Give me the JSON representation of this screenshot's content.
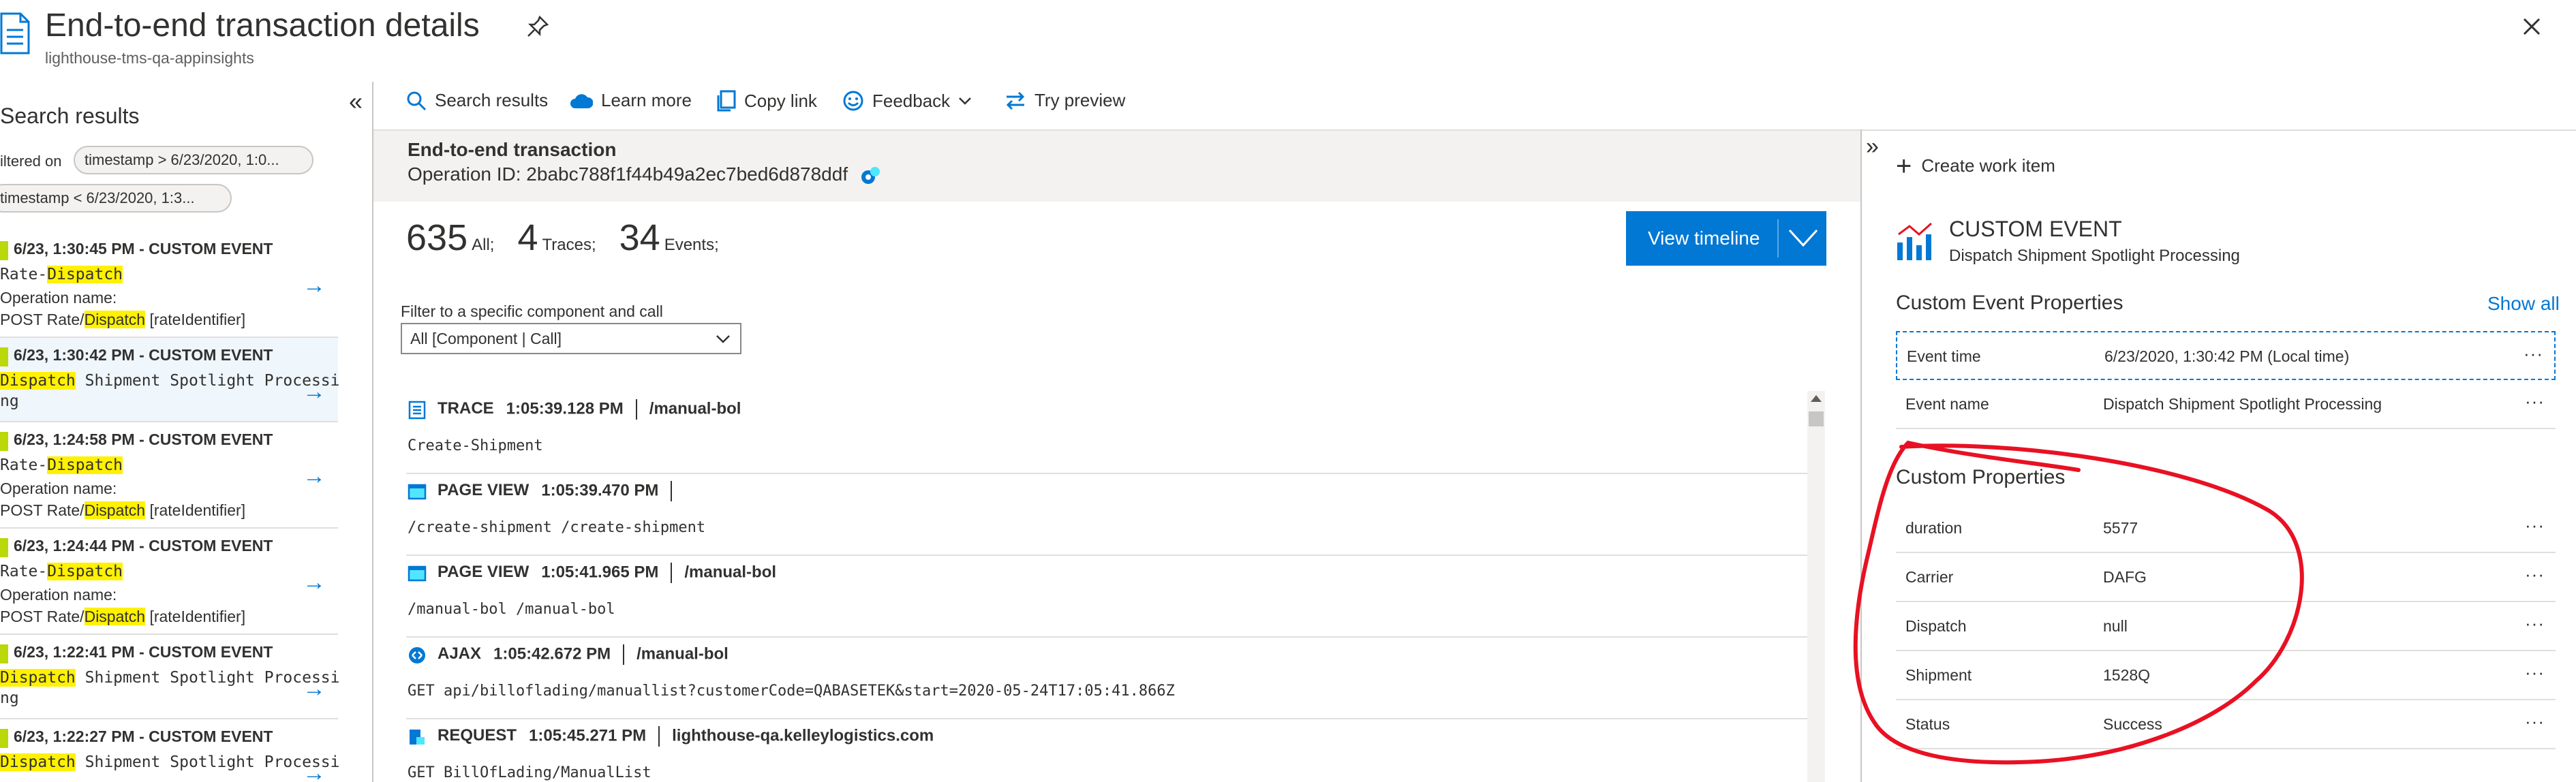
{
  "header": {
    "title": "End-to-end transaction details",
    "subtitle": "lighthouse-tms-qa-appinsights"
  },
  "left_panel": {
    "title": "Search results",
    "filter_label": "iltered on",
    "chips": [
      "timestamp > 6/23/2020, 1:0...",
      "timestamp < 6/23/2020, 1:3..."
    ],
    "results": [
      {
        "header": "6/23, 1:30:45 PM - CUSTOM EVENT",
        "line1_pre": "Rate-",
        "line1_hl": "Dispatch",
        "line1_post": "",
        "op_label": "Operation name:",
        "op_pre": "POST Rate/",
        "op_hl": "Dispatch",
        "op_post": " [rateIdentifier]"
      },
      {
        "header": "6/23, 1:30:42 PM - CUSTOM EVENT",
        "line1_pre": "",
        "line1_hl": "Dispatch",
        "line1_post": " Shipment Spotlight Processi",
        "line2": "ng"
      },
      {
        "header": "6/23, 1:24:58 PM - CUSTOM EVENT",
        "line1_pre": "Rate-",
        "line1_hl": "Dispatch",
        "line1_post": "",
        "op_label": "Operation name:",
        "op_pre": "POST Rate/",
        "op_hl": "Dispatch",
        "op_post": " [rateIdentifier]"
      },
      {
        "header": "6/23, 1:24:44 PM - CUSTOM EVENT",
        "line1_pre": "Rate-",
        "line1_hl": "Dispatch",
        "line1_post": "",
        "op_label": "Operation name:",
        "op_pre": "POST Rate/",
        "op_hl": "Dispatch",
        "op_post": " [rateIdentifier]"
      },
      {
        "header": "6/23, 1:22:41 PM - CUSTOM EVENT",
        "line1_pre": "",
        "line1_hl": "Dispatch",
        "line1_post": " Shipment Spotlight Processi",
        "line2": "ng"
      },
      {
        "header": "6/23, 1:22:27 PM - CUSTOM EVENT",
        "line1_pre": "",
        "line1_hl": "Dispatch",
        "line1_post": " Shipment Spotlight Processi",
        "line2": ""
      }
    ]
  },
  "toolbar": {
    "search_results": "Search results",
    "learn_more": "Learn more",
    "copy_link": "Copy link",
    "feedback": "Feedback",
    "try_preview": "Try preview"
  },
  "transaction": {
    "title": "End-to-end transaction",
    "operation_id": "Operation ID: 2babc788f1f44b49a2ec7bed6d878ddf",
    "counts": [
      {
        "value": "635",
        "label": "All;"
      },
      {
        "value": "4",
        "label": "Traces;"
      },
      {
        "value": "34",
        "label": "Events;"
      }
    ],
    "view_timeline": "View timeline",
    "filter_label": "Filter to a specific component and call",
    "filter_value": "All [Component | Call]"
  },
  "telemetry": [
    {
      "type": "TRACE",
      "time": "1:05:39.128 PM",
      "target": "/manual-bol",
      "detail": "Create-Shipment",
      "icon": "trace-icon"
    },
    {
      "type": "PAGE VIEW",
      "time": "1:05:39.470 PM",
      "target": "",
      "detail": "/create-shipment /create-shipment",
      "icon": "page-view-icon"
    },
    {
      "type": "PAGE VIEW",
      "time": "1:05:41.965 PM",
      "target": "/manual-bol",
      "detail": "/manual-bol /manual-bol",
      "icon": "page-view-icon"
    },
    {
      "type": "AJAX",
      "time": "1:05:42.672 PM",
      "target": "/manual-bol",
      "detail": "GET api/billoflading/manuallist?customerCode=QABASETEK&start=2020-05-24T17:05:41.866Z",
      "icon": "ajax-icon"
    },
    {
      "type": "REQUEST",
      "time": "1:05:45.271 PM",
      "target": "lighthouse-qa.kelleylogistics.com",
      "detail": "GET BillOfLading/ManualList",
      "icon": "request-icon"
    }
  ],
  "right_panel": {
    "create_work_item": "Create work item",
    "event_type": "CUSTOM EVENT",
    "event_name": "Dispatch Shipment Spotlight Processing",
    "event_props_title": "Custom Event Properties",
    "show_all": "Show all",
    "event_props": [
      {
        "key": "Event time",
        "value": "6/23/2020, 1:30:42 PM (Local time)"
      },
      {
        "key": "Event name",
        "value": "Dispatch Shipment Spotlight Processing"
      }
    ],
    "custom_props_title": "Custom Properties",
    "custom_props": [
      {
        "key": "duration",
        "value": "5577"
      },
      {
        "key": "Carrier",
        "value": "DAFG"
      },
      {
        "key": "Dispatch",
        "value": "null"
      },
      {
        "key": "Shipment",
        "value": "1528Q"
      },
      {
        "key": "Status",
        "value": "Success"
      }
    ],
    "more_glyph": "···"
  },
  "colors": {
    "accent": "#0078d4",
    "highlight": "#fff100",
    "event_bar": "#bad80a",
    "annotation": "#e81123"
  }
}
